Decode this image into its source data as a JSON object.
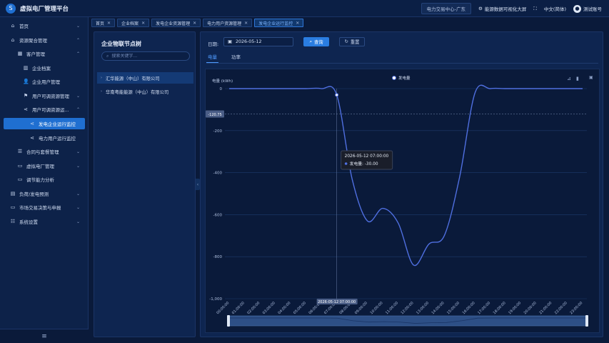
{
  "app": {
    "title": "虚拟电厂管理平台",
    "logo_icon": "swirl-logo-icon"
  },
  "header": {
    "market_chip": "电力交易中心-广东",
    "link_energy": "能源数据可视化大屏",
    "link_lang": "中文(简体)",
    "user_name": "测试账号"
  },
  "sidebar": {
    "items": [
      {
        "label": "首页",
        "icon": "home-icon"
      },
      {
        "label": "资源聚合管理",
        "icon": "home-icon"
      },
      {
        "label": "客户管理",
        "icon": "grid-icon"
      },
      {
        "label": "企业档案",
        "icon": "building-icon"
      },
      {
        "label": "企业用户管理",
        "icon": "user-icon"
      },
      {
        "label": "用户可调资源管理",
        "icon": "flag-icon"
      },
      {
        "label": "用户可调资源运...",
        "icon": "share-icon"
      },
      {
        "label": "发电企业运行监控",
        "icon": "share-icon"
      },
      {
        "label": "电力用户运行监控",
        "icon": "share-icon"
      },
      {
        "label": "合同与套餐管理",
        "icon": "list-icon"
      },
      {
        "label": "虚拟电厂管理",
        "icon": "monitor-icon"
      },
      {
        "label": "调节能力分析",
        "icon": "monitor-icon"
      },
      {
        "label": "负荷/发电预测",
        "icon": "chart-icon"
      },
      {
        "label": "市场交易决策与申报",
        "icon": "monitor-icon"
      },
      {
        "label": "系统设置",
        "icon": "sliders-icon"
      }
    ],
    "footer_icon": "menu-icon"
  },
  "tabs": [
    {
      "label": "首页"
    },
    {
      "label": "企业档案"
    },
    {
      "label": "发电企业资源管理"
    },
    {
      "label": "电力用户资源管理"
    },
    {
      "label": "发电企业运行监控"
    }
  ],
  "tree": {
    "title": "企业物联节点树",
    "search_placeholder": "搜索关键字...",
    "nodes": [
      {
        "label": "汇华能源（中山）有限公司"
      },
      {
        "label": "华南粤能能源（中山）有限公司"
      }
    ]
  },
  "filter": {
    "date_label": "日期:",
    "date_value": "2026-05-12",
    "query_label": "查询",
    "reset_label": "重置"
  },
  "sub_tabs": [
    {
      "label": "电量"
    },
    {
      "label": "功率"
    }
  ],
  "chart_data": {
    "type": "line",
    "title": "",
    "ylabel": "电量 (kWh)",
    "xlabel": "",
    "ylim": [
      -1000,
      0
    ],
    "yticks": [
      0,
      -200,
      -400,
      -600,
      -800,
      -1000
    ],
    "ytick_labels": [
      "0",
      "-200",
      "-400",
      "-600",
      "-800",
      "-1,000"
    ],
    "grid": true,
    "legend": "top-center",
    "x": [
      "00:00:00",
      "01:00:00",
      "02:00:00",
      "03:00:00",
      "04:00:00",
      "05:00:00",
      "06:00:00",
      "07:00:00",
      "08:00:00",
      "09:00:00",
      "10:00:00",
      "11:00:00",
      "12:00:00",
      "13:00:00",
      "14:00:00",
      "15:00:00",
      "16:00:00",
      "17:00:00",
      "18:00:00",
      "19:00:00",
      "20:00:00",
      "21:00:00",
      "22:00:00",
      "23:00:00"
    ],
    "x_prefix": "2026-05-12 ",
    "series": [
      {
        "name": "发电量",
        "values": [
          0,
          0,
          0,
          0,
          0,
          0,
          0,
          -30,
          -430,
          -630,
          -570,
          -640,
          -840,
          -740,
          -700,
          -420,
          -20,
          0,
          0,
          0,
          0,
          0,
          0,
          0
        ]
      }
    ],
    "tooltip": {
      "title": "2026-05-12 07:00:00",
      "label": "发电量: ",
      "value": "-30.00"
    },
    "axis_pointer_y": "-120.75",
    "axis_pointer_x": "2026-05-12 07:00:00",
    "line_color": "#4f6fe0"
  }
}
